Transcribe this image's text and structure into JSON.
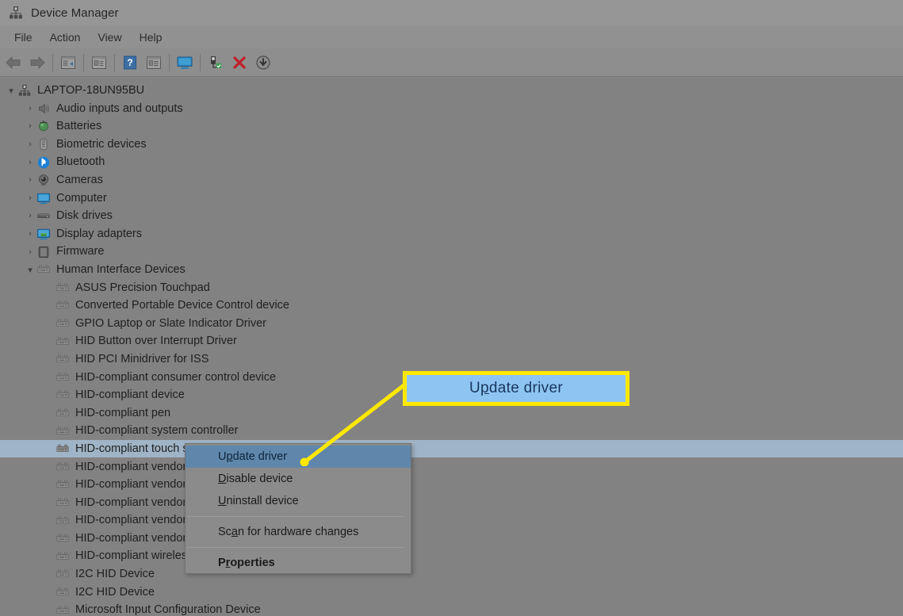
{
  "window": {
    "title": "Device Manager",
    "icon": "device-manager-icon"
  },
  "menubar": {
    "items": [
      {
        "label": "File",
        "name": "menu-file"
      },
      {
        "label": "Action",
        "name": "menu-action"
      },
      {
        "label": "View",
        "name": "menu-view"
      },
      {
        "label": "Help",
        "name": "menu-help"
      }
    ]
  },
  "toolbar": {
    "buttons": [
      {
        "name": "back-button",
        "icon": "back-arrow-icon"
      },
      {
        "name": "forward-button",
        "icon": "forward-arrow-icon"
      },
      {
        "name": "properties-button",
        "icon": "properties-icon"
      },
      {
        "name": "update-driver-button",
        "icon": "update-driver-icon"
      },
      {
        "name": "help-button",
        "icon": "help-question-icon"
      },
      {
        "name": "show-hidden-button",
        "icon": "show-hidden-icon"
      },
      {
        "name": "scan-hardware-button",
        "icon": "monitor-icon"
      },
      {
        "name": "enable-device-button",
        "icon": "enable-device-icon"
      },
      {
        "name": "uninstall-device-button",
        "icon": "red-x-icon"
      },
      {
        "name": "download-button",
        "icon": "download-arrow-icon"
      }
    ]
  },
  "tree": {
    "root": {
      "label": "LAPTOP-18UN95BU",
      "icon": "computer-root-icon",
      "expanded": true
    },
    "categories": [
      {
        "label": "Audio inputs and outputs",
        "icon": "speaker-icon",
        "expanded": false
      },
      {
        "label": "Batteries",
        "icon": "battery-icon",
        "expanded": false
      },
      {
        "label": "Biometric devices",
        "icon": "fingerprint-icon",
        "expanded": false
      },
      {
        "label": "Bluetooth",
        "icon": "bluetooth-icon",
        "expanded": false
      },
      {
        "label": "Cameras",
        "icon": "camera-icon",
        "expanded": false
      },
      {
        "label": "Computer",
        "icon": "monitor-icon",
        "expanded": false
      },
      {
        "label": "Disk drives",
        "icon": "disk-drive-icon",
        "expanded": false
      },
      {
        "label": "Display adapters",
        "icon": "display-adapter-icon",
        "expanded": false
      },
      {
        "label": "Firmware",
        "icon": "firmware-icon",
        "expanded": false
      },
      {
        "label": "Human Interface Devices",
        "icon": "hid-icon",
        "expanded": true
      }
    ],
    "hid_devices": [
      {
        "label": "ASUS Precision Touchpad",
        "selected": false
      },
      {
        "label": "Converted Portable Device Control device",
        "selected": false
      },
      {
        "label": "GPIO Laptop or Slate Indicator Driver",
        "selected": false
      },
      {
        "label": "HID Button over Interrupt Driver",
        "selected": false
      },
      {
        "label": "HID PCI Minidriver for ISS",
        "selected": false
      },
      {
        "label": "HID-compliant consumer control device",
        "selected": false
      },
      {
        "label": "HID-compliant device",
        "selected": false
      },
      {
        "label": "HID-compliant pen",
        "selected": false
      },
      {
        "label": "HID-compliant system controller",
        "selected": false
      },
      {
        "label": "HID-compliant touch screen",
        "selected": true
      },
      {
        "label": "HID-compliant vendor-defined device",
        "selected": false
      },
      {
        "label": "HID-compliant vendor-defined device",
        "selected": false
      },
      {
        "label": "HID-compliant vendor-defined device",
        "selected": false
      },
      {
        "label": "HID-compliant vendor-defined device",
        "selected": false
      },
      {
        "label": "HID-compliant vendor-defined device",
        "selected": false
      },
      {
        "label": "HID-compliant wireless radio controls",
        "selected": false
      },
      {
        "label": "I2C HID Device",
        "selected": false
      },
      {
        "label": "I2C HID Device",
        "selected": false
      },
      {
        "label": "Microsoft Input Configuration Device",
        "selected": false
      }
    ]
  },
  "context_menu": {
    "items": [
      {
        "label": "Update driver",
        "accel": "p",
        "highlighted": true,
        "bold": false
      },
      {
        "label": "Disable device",
        "accel": "D",
        "highlighted": false,
        "bold": false
      },
      {
        "label": "Uninstall device",
        "accel": "U",
        "highlighted": false,
        "bold": false
      },
      {
        "label": "Scan for hardware changes",
        "accel": "a",
        "highlighted": false,
        "bold": false
      },
      {
        "label": "Properties",
        "accel": "r",
        "highlighted": false,
        "bold": true
      }
    ]
  },
  "callout": {
    "text": "Update driver",
    "border_color": "#ffe800",
    "fill_color": "#8ec5f0",
    "text_color": "#17365d",
    "leader_color": "#ffe800"
  },
  "colors": {
    "window_background": "#828282",
    "titlebar": "#969696",
    "menubar": "#919191",
    "toolbar": "#8e8e8e",
    "selection": "#9fb4c6",
    "menu_highlight": "#5e87ab",
    "context_menu_bg": "#8b8b8b"
  }
}
